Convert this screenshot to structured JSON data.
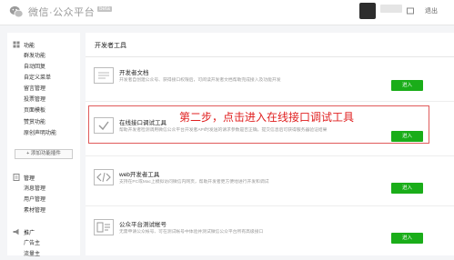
{
  "header": {
    "logo_text": "微信·公众平台",
    "beta_badge": "beta",
    "logout": "退出"
  },
  "sidebar": {
    "groups": [
      {
        "label": "功能",
        "icon": "grid-icon",
        "items": [
          "群发功能",
          "自动回复",
          "自定义菜单",
          "留言管理",
          "投票管理",
          "页面模板",
          "赞赏功能",
          "原创声明功能"
        ]
      },
      {
        "label": "管理",
        "icon": "document-icon",
        "items": [
          "消息管理",
          "用户管理",
          "素材管理"
        ]
      },
      {
        "label": "推广",
        "icon": "megaphone-icon",
        "items": [
          "广告主",
          "流量主"
        ]
      }
    ],
    "add_plugin": "+ 添加功能插件"
  },
  "main": {
    "title": "开发者工具",
    "enter_label": "进入",
    "annotation": "第二步，点击进入在线接口调试工具",
    "tools": [
      {
        "title": "开发者文档",
        "desc": "开发者自创建公众号、获得接口权限后，可阅读开发者文档帮助完成接入及功能开发",
        "icon": "document-icon"
      },
      {
        "title": "在线接口调试工具",
        "desc": "帮助开发者检测调用微信公众平台开发者API时发送的请求参数是否正确，提交信息后可获得服务器验证结果",
        "icon": "check-icon"
      },
      {
        "title": "web开发者工具",
        "desc": "支持在PC或Mac上模拟访问微信内网页，帮助开发者更方便地进行开发和调试",
        "icon": "code-icon"
      },
      {
        "title": "公众平台测试帐号",
        "desc": "无需申请公众帐号、可在测试帐号中体验并测试微信公众平台所有高级接口",
        "icon": "test-account-icon"
      }
    ]
  },
  "colors": {
    "accent": "#1aad19",
    "annotation": "#e02020",
    "highlight_border": "#e05a5a"
  }
}
